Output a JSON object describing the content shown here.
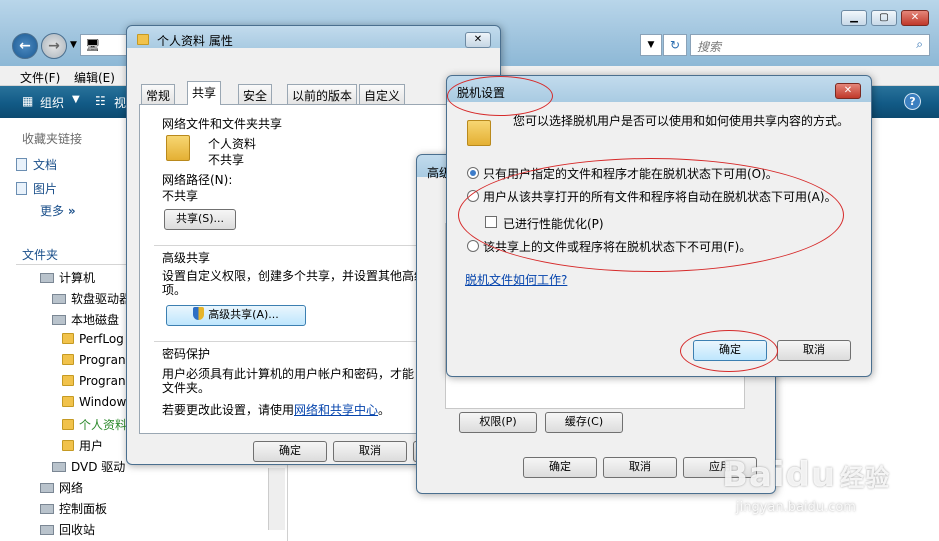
{
  "explorer": {
    "search_placeholder": "搜索",
    "menu": [
      "文件(F)",
      "编辑(E)"
    ],
    "toolbar": {
      "organize": "组织",
      "view": "视"
    },
    "favorites_title": "收藏夹链接",
    "favorites": [
      "文档",
      "图片",
      "更多"
    ],
    "folders_title": "文件夹",
    "tree": [
      "计算机",
      "软盘驱动器",
      "本地磁盘",
      "PerfLog",
      "Progran",
      "Progran",
      "Window",
      "个人资料",
      "用户",
      "DVD 驱动",
      "网络",
      "控制面板",
      "回收站"
    ]
  },
  "properties": {
    "title": "个人资料 属性",
    "tabs": [
      "常规",
      "共享",
      "安全",
      "以前的版本",
      "自定义"
    ],
    "share_section": "网络文件和文件夹共享",
    "folder_name": "个人资料",
    "folder_state": "不共享",
    "network_path_label": "网络路径(N):",
    "network_path_value": "不共享",
    "share_button": "共享(S)...",
    "advanced_section": "高级共享",
    "advanced_desc1": "设置自定义权限，创建多个共享，并设置其他高级",
    "advanced_desc2": "项。",
    "advanced_button": "高级共享(A)...",
    "password_section": "密码保护",
    "password_desc1": "用户必须具有此计算机的用户帐户和密码，才能",
    "password_desc2": "文件夹。",
    "change_prefix": "若要更改此设置，请使用",
    "change_link": "网络和共享中心",
    "change_suffix": "。",
    "ok": "确定",
    "cancel": "取消"
  },
  "advanced_dialog": {
    "title_partial": "高级",
    "permissions": "权限(P)",
    "caching": "缓存(C)",
    "ok": "确定",
    "cancel": "取消",
    "apply": "应用"
  },
  "offline": {
    "title": "脱机设置",
    "desc": "您可以选择脱机用户是否可以使用和如何使用共享内容的方式。",
    "option1": "只有用户指定的文件和程序才能在脱机状态下可用(O)。",
    "option2": "用户从该共享打开的所有文件和程序将自动在脱机状态下可用(A)。",
    "optimize": "已进行性能优化(P)",
    "option3": "该共享上的文件或程序将在脱机状态下不可用(F)。",
    "help_link": "脱机文件如何工作?",
    "ok": "确定",
    "cancel": "取消"
  },
  "watermark": {
    "brand": "Baidu",
    "cn": "经验",
    "url": "jingyan.baidu.com"
  }
}
